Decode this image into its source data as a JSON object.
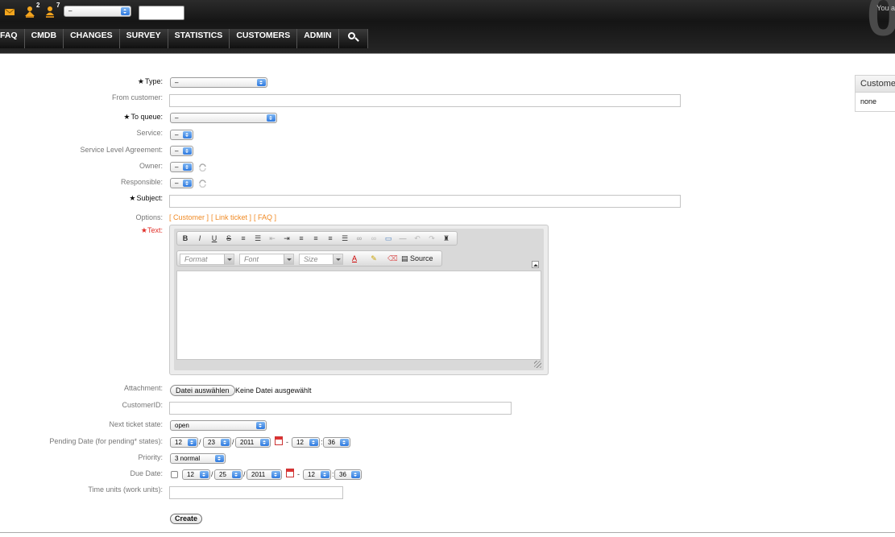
{
  "header": {
    "user_text": "You a",
    "big_number": "0",
    "escalation_count": "2",
    "responsible_count": "7",
    "queue_select_value": "–",
    "nav": [
      "FAQ",
      "CMDB",
      "CHANGES",
      "SURVEY",
      "STATISTICS",
      "CUSTOMERS",
      "ADMIN"
    ]
  },
  "form": {
    "type": {
      "label": "Type:",
      "value": "–"
    },
    "from_customer": {
      "label": "From customer:",
      "value": ""
    },
    "to_queue": {
      "label": "To queue:",
      "value": "–"
    },
    "service": {
      "label": "Service:",
      "value": "–"
    },
    "sla": {
      "label": "Service Level Agreement:",
      "value": "–"
    },
    "owner": {
      "label": "Owner:",
      "value": "–"
    },
    "responsible": {
      "label": "Responsible:",
      "value": "–"
    },
    "subject": {
      "label": "Subject:",
      "value": ""
    },
    "options": {
      "label": "Options:",
      "customer": "[ Customer ]",
      "link_ticket": "[ Link ticket ]",
      "faq": "[ FAQ ]"
    },
    "text": {
      "label": "Text:"
    },
    "editor": {
      "format_placeholder": "Format",
      "font_placeholder": "Font",
      "size_placeholder": "Size",
      "source_label": "Source",
      "toolbar_icons": [
        "bold-icon",
        "italic-icon",
        "underline-icon",
        "strikethrough-icon",
        "numbered-list-icon",
        "bullet-list-icon",
        "outdent-icon",
        "indent-icon",
        "align-left-icon",
        "align-center-icon",
        "align-right-icon",
        "justify-icon",
        "link-icon",
        "unlink-icon",
        "image-icon",
        "horizontal-rule-icon",
        "undo-icon",
        "redo-icon",
        "find-icon"
      ]
    },
    "attachment": {
      "label": "Attachment:",
      "button": "Datei auswählen",
      "status": "Keine Datei ausgewählt"
    },
    "customer_id": {
      "label": "CustomerID:",
      "value": ""
    },
    "next_state": {
      "label": "Next ticket state:",
      "value": "open"
    },
    "pending_date": {
      "label": "Pending Date (for pending* states):",
      "month": "12",
      "day": "23",
      "year": "2011",
      "hour": "12",
      "minute": "36"
    },
    "priority": {
      "label": "Priority:",
      "value": "3 normal"
    },
    "due_date": {
      "label": "Due Date:",
      "month": "12",
      "day": "25",
      "year": "2011",
      "hour": "12",
      "minute": "36"
    },
    "time_units": {
      "label": "Time units (work units):",
      "value": ""
    },
    "create_button": "Create"
  },
  "side_panel": {
    "title": "Customer",
    "value": "none"
  },
  "colors": {
    "link_orange": "#f08a24",
    "required_red": "#e0302a",
    "select_blue": "#2f7ae0"
  }
}
